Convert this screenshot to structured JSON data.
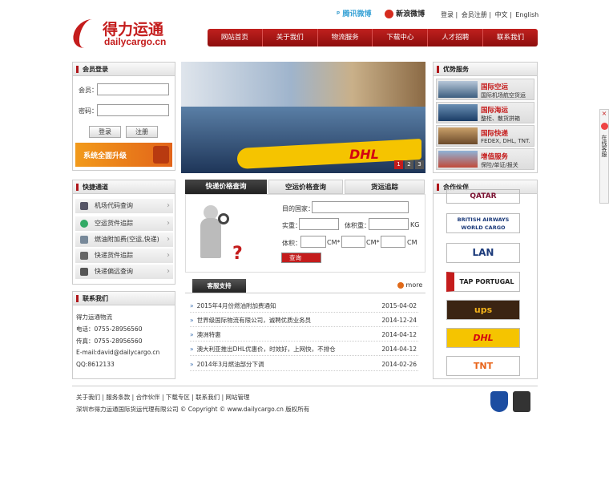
{
  "logo": {
    "cn": "得力运通",
    "en": "dailycargo.cn"
  },
  "social": {
    "tencent": "腾讯微博",
    "sina": "新浪微博"
  },
  "toplinks": [
    "登录",
    "会员注册",
    "中文",
    "English"
  ],
  "nav": [
    "网站首页",
    "关于我们",
    "物流服务",
    "下载中心",
    "人才招聘",
    "联系我们"
  ],
  "login": {
    "title": "会员登录",
    "user_label": "会员：",
    "pass_label": "密码：",
    "login_btn": "登录",
    "register_btn": "注册",
    "banner": "系统全面升级"
  },
  "slider": {
    "pages": [
      "1",
      "2",
      "3"
    ]
  },
  "services": {
    "title": "优势服务",
    "items": [
      {
        "t1": "国际空运",
        "t2": "国际机场航空货运"
      },
      {
        "t1": "国际海运",
        "t2": "整柜、散货拼箱"
      },
      {
        "t1": "国际快递",
        "t2": "FEDEX, DHL, TNT."
      },
      {
        "t1": "增值服务",
        "t2": "保险/单证/报关"
      }
    ]
  },
  "quick": {
    "title": "快捷通道",
    "items": [
      "机场代码查询",
      "空运货件追踪",
      "燃油附加费(空运,快递)",
      "快递货件追踪",
      "快递偏远查询"
    ]
  },
  "contact": {
    "title": "联系我们",
    "company": "得力运通物流",
    "phone": "电话：0755-28956560",
    "fax": "传真：0755-28956560",
    "email": "E-mail:david@dailycargo.cn",
    "qq": "QQ:8612133"
  },
  "tabs": [
    "快递价格查询",
    "空运价格查询",
    "货运追踪"
  ],
  "price": {
    "country": "目的国家：",
    "actual": "实重：",
    "volume_w": "体积重：",
    "kg": "KG",
    "volume": "体积：",
    "cm1": "CM*",
    "cm2": "CM*",
    "cm3": "CM",
    "query": "查询"
  },
  "support": {
    "title": "客服支持",
    "more": "more",
    "items": [
      {
        "text": "2015年4月份燃油附加费通知",
        "date": "2015-04-02"
      },
      {
        "text": "世界级国际物流有限公司，诚聘优质业务员",
        "date": "2014-12-24"
      },
      {
        "text": "澳洲特惠",
        "date": "2014-04-12"
      },
      {
        "text": "澳大利亚推出DHL优惠价，时效好，上网快，不排仓",
        "date": "2014-04-12"
      },
      {
        "text": "2014年3月燃油部分下调",
        "date": "2014-02-26"
      }
    ]
  },
  "partners": {
    "title": "合作伙伴",
    "items": [
      "QATAR",
      "BRITISH AIRWAYS WORLD CARGO",
      "LAN",
      "TAP PORTUGAL",
      "ups",
      "DHL",
      "TNT"
    ]
  },
  "footer": {
    "links": "关于我们 | 服务条款 | 合作伙伴 | 下载专区 | 联系我们 | 网站管理",
    "copyright": "深圳市得力运通国际货运代理有限公司 © Copyright © www.dailycargo.cn 版权所有"
  },
  "side": {
    "label": "在线客服",
    "close": "×"
  }
}
